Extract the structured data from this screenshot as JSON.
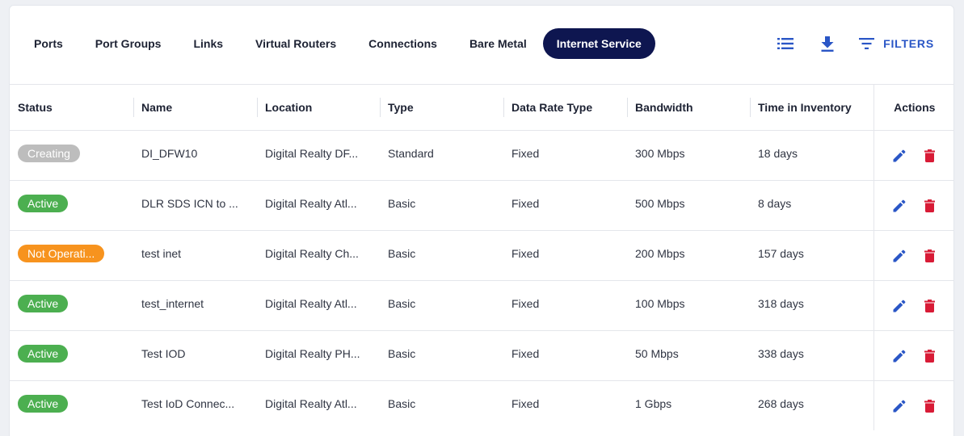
{
  "tabs": [
    {
      "label": "Ports",
      "active": false
    },
    {
      "label": "Port Groups",
      "active": false
    },
    {
      "label": "Links",
      "active": false
    },
    {
      "label": "Virtual Routers",
      "active": false
    },
    {
      "label": "Connections",
      "active": false
    },
    {
      "label": "Bare Metal",
      "active": false
    },
    {
      "label": "Internet Service",
      "active": true
    }
  ],
  "toolbar": {
    "list_icon": "list-view-icon",
    "download_icon": "download-icon",
    "filter_icon": "filter-icon",
    "filters_label": "FILTERS"
  },
  "colors": {
    "accent": "#2a56c6",
    "active_tab_bg": "#0e1650",
    "status_active": "#4caf50",
    "status_creating": "#bdbdbd",
    "status_not_operational": "#f7931e",
    "delete": "#d81b36"
  },
  "table": {
    "columns": [
      "Status",
      "Name",
      "Location",
      "Type",
      "Data Rate Type",
      "Bandwidth",
      "Time in Inventory",
      "Actions"
    ],
    "rows": [
      {
        "status": "Creating",
        "status_kind": "creating",
        "name": "DI_DFW10",
        "location": "Digital Realty DF...",
        "type": "Standard",
        "data_rate_type": "Fixed",
        "bandwidth": "300 Mbps",
        "time_in_inventory": "18 days"
      },
      {
        "status": "Active",
        "status_kind": "active",
        "name": "DLR SDS ICN to ...",
        "location": "Digital Realty Atl...",
        "type": "Basic",
        "data_rate_type": "Fixed",
        "bandwidth": "500 Mbps",
        "time_in_inventory": "8 days"
      },
      {
        "status": "Not Operati...",
        "status_kind": "not_operational",
        "name": "test inet",
        "location": "Digital Realty Ch...",
        "type": "Basic",
        "data_rate_type": "Fixed",
        "bandwidth": "200 Mbps",
        "time_in_inventory": "157 days"
      },
      {
        "status": "Active",
        "status_kind": "active",
        "name": "test_internet",
        "location": "Digital Realty Atl...",
        "type": "Basic",
        "data_rate_type": "Fixed",
        "bandwidth": "100 Mbps",
        "time_in_inventory": "318 days"
      },
      {
        "status": "Active",
        "status_kind": "active",
        "name": "Test IOD",
        "location": "Digital Realty PH...",
        "type": "Basic",
        "data_rate_type": "Fixed",
        "bandwidth": "50 Mbps",
        "time_in_inventory": "338 days"
      },
      {
        "status": "Active",
        "status_kind": "active",
        "name": "Test IoD Connec...",
        "location": "Digital Realty Atl...",
        "type": "Basic",
        "data_rate_type": "Fixed",
        "bandwidth": "1 Gbps",
        "time_in_inventory": "268 days"
      }
    ],
    "row_actions": {
      "edit_icon": "edit-pencil-icon",
      "delete_icon": "delete-trash-icon"
    }
  }
}
